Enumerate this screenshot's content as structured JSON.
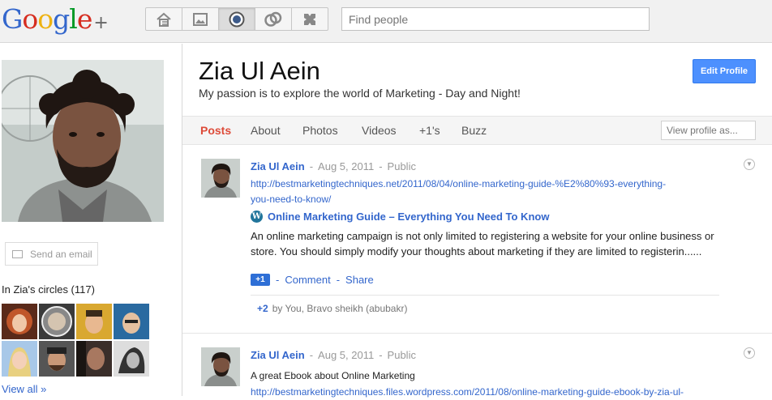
{
  "header": {
    "logo_letters": [
      "G",
      "o",
      "o",
      "g",
      "l",
      "e"
    ],
    "logo_plus": "+",
    "nav_icons": [
      "home-icon",
      "photos-icon",
      "profile-icon",
      "circles-icon",
      "games-icon"
    ],
    "active_nav": "profile-icon",
    "search_placeholder": "Find people"
  },
  "sidebar": {
    "send_email_label": "Send an email",
    "circles_title": "In Zia's circles (117)",
    "view_all_label": "View all »"
  },
  "profile": {
    "name": "Zia Ul Aein",
    "tagline": "My passion is to explore the world of Marketing - Day and Night!",
    "edit_profile_label": "Edit Profile"
  },
  "tabs": {
    "items": [
      "Posts",
      "About",
      "Photos",
      "Videos",
      "+1's",
      "Buzz"
    ],
    "active": "Posts",
    "view_as_placeholder": "View profile as..."
  },
  "posts": [
    {
      "author": "Zia Ul Aein",
      "date": "Aug 5, 2011",
      "visibility": "Public",
      "link_line1": "http://bestmarketingtechniques.net/2011/08/04/online-marketing-guide-%E2%80%93-everything-",
      "link_line2": "you-need-to-know/",
      "share_title": "Online Marketing Guide – Everything You Need To Know",
      "share_desc": "An online marketing campaign is not only limited to registering a website for your online business or store. You should simply modify your thoughts about marketing if they are limited to registerin......",
      "plusone_label": "+1",
      "comment_label": "Comment",
      "share_label": "Share",
      "plus_count": "+2",
      "plus_by": "by You, Bravo sheikh (abubakr)"
    },
    {
      "author": "Zia Ul Aein",
      "date": "Aug 5, 2011",
      "visibility": "Public",
      "text": "A great Ebook about Online Marketing",
      "link_line1": "http://bestmarketingtechniques.files.wordpress.com/2011/08/online-marketing-guide-ebook-by-zia-ul-"
    }
  ],
  "colors": {
    "accent_blue": "#3366cc",
    "active_tab": "#dd4b39",
    "button_blue": "#4d90fe"
  }
}
